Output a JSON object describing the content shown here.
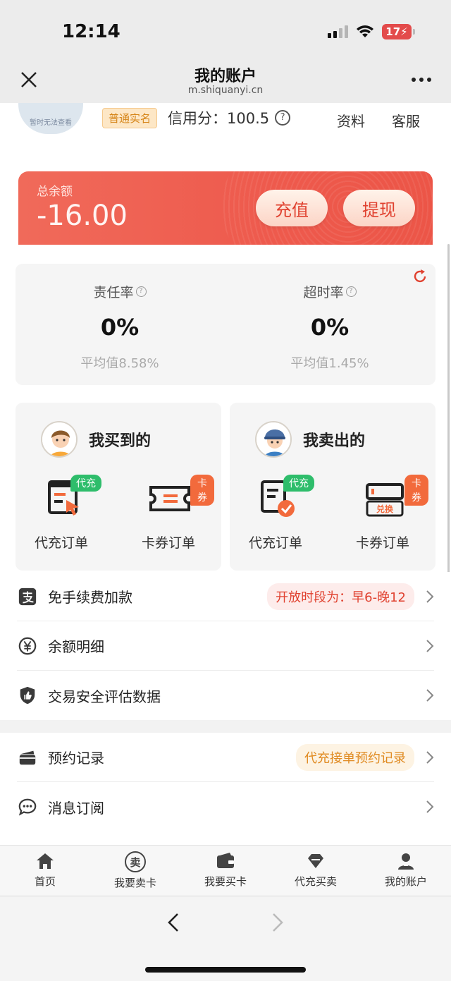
{
  "status": {
    "time": "12:14",
    "battery": "17"
  },
  "header": {
    "title": "我的账户",
    "url": "m.shiquanyi.cn"
  },
  "profile": {
    "avatar_text": "暂时无法查看",
    "realname_badge": "普通实名",
    "credit_label": "信用分：",
    "credit_value": "100.5",
    "profile_link": "资料",
    "service_link": "客服"
  },
  "balance": {
    "label": "总余额",
    "value": "-16.00",
    "recharge": "充值",
    "withdraw": "提现"
  },
  "stats": [
    {
      "label": "责任率",
      "value": "0%",
      "avg": "平均值8.58%"
    },
    {
      "label": "超时率",
      "value": "0%",
      "avg": "平均值1.45%"
    }
  ],
  "orders": {
    "buy": {
      "title": "我买到的",
      "items": [
        {
          "label": "代充订单",
          "tag": "代充"
        },
        {
          "label": "卡券订单",
          "tag": "卡券"
        }
      ]
    },
    "sell": {
      "title": "我卖出的",
      "items": [
        {
          "label": "代充订单",
          "tag": "代充"
        },
        {
          "label": "卡券订单",
          "tag": "卡券",
          "icon_text": "兑换"
        }
      ]
    }
  },
  "menu1": [
    {
      "label": "免手续费加款",
      "badge": "开放时段为：早6-晚12",
      "icon": "alipay-icon"
    },
    {
      "label": "余额明细",
      "icon": "yuan-icon"
    },
    {
      "label": "交易安全评估数据",
      "icon": "shield-thumb-icon"
    }
  ],
  "menu2": [
    {
      "label": "预约记录",
      "badge": "代充接单预约记录",
      "icon": "wallet-card-icon"
    },
    {
      "label": "消息订阅",
      "icon": "chat-bubble-icon"
    }
  ],
  "tabs": [
    {
      "label": "首页",
      "icon": "home-icon"
    },
    {
      "label": "我要卖卡",
      "icon": "sell-circle-icon",
      "icon_text": "卖"
    },
    {
      "label": "我要买卡",
      "icon": "wallet-icon"
    },
    {
      "label": "代充买卖",
      "icon": "diamond-icon"
    },
    {
      "label": "我的账户",
      "icon": "user-icon"
    }
  ],
  "colors": {
    "accent": "#ee5a4d",
    "green_tag": "#2ebd6b",
    "orange_tag": "#f26a3c"
  }
}
